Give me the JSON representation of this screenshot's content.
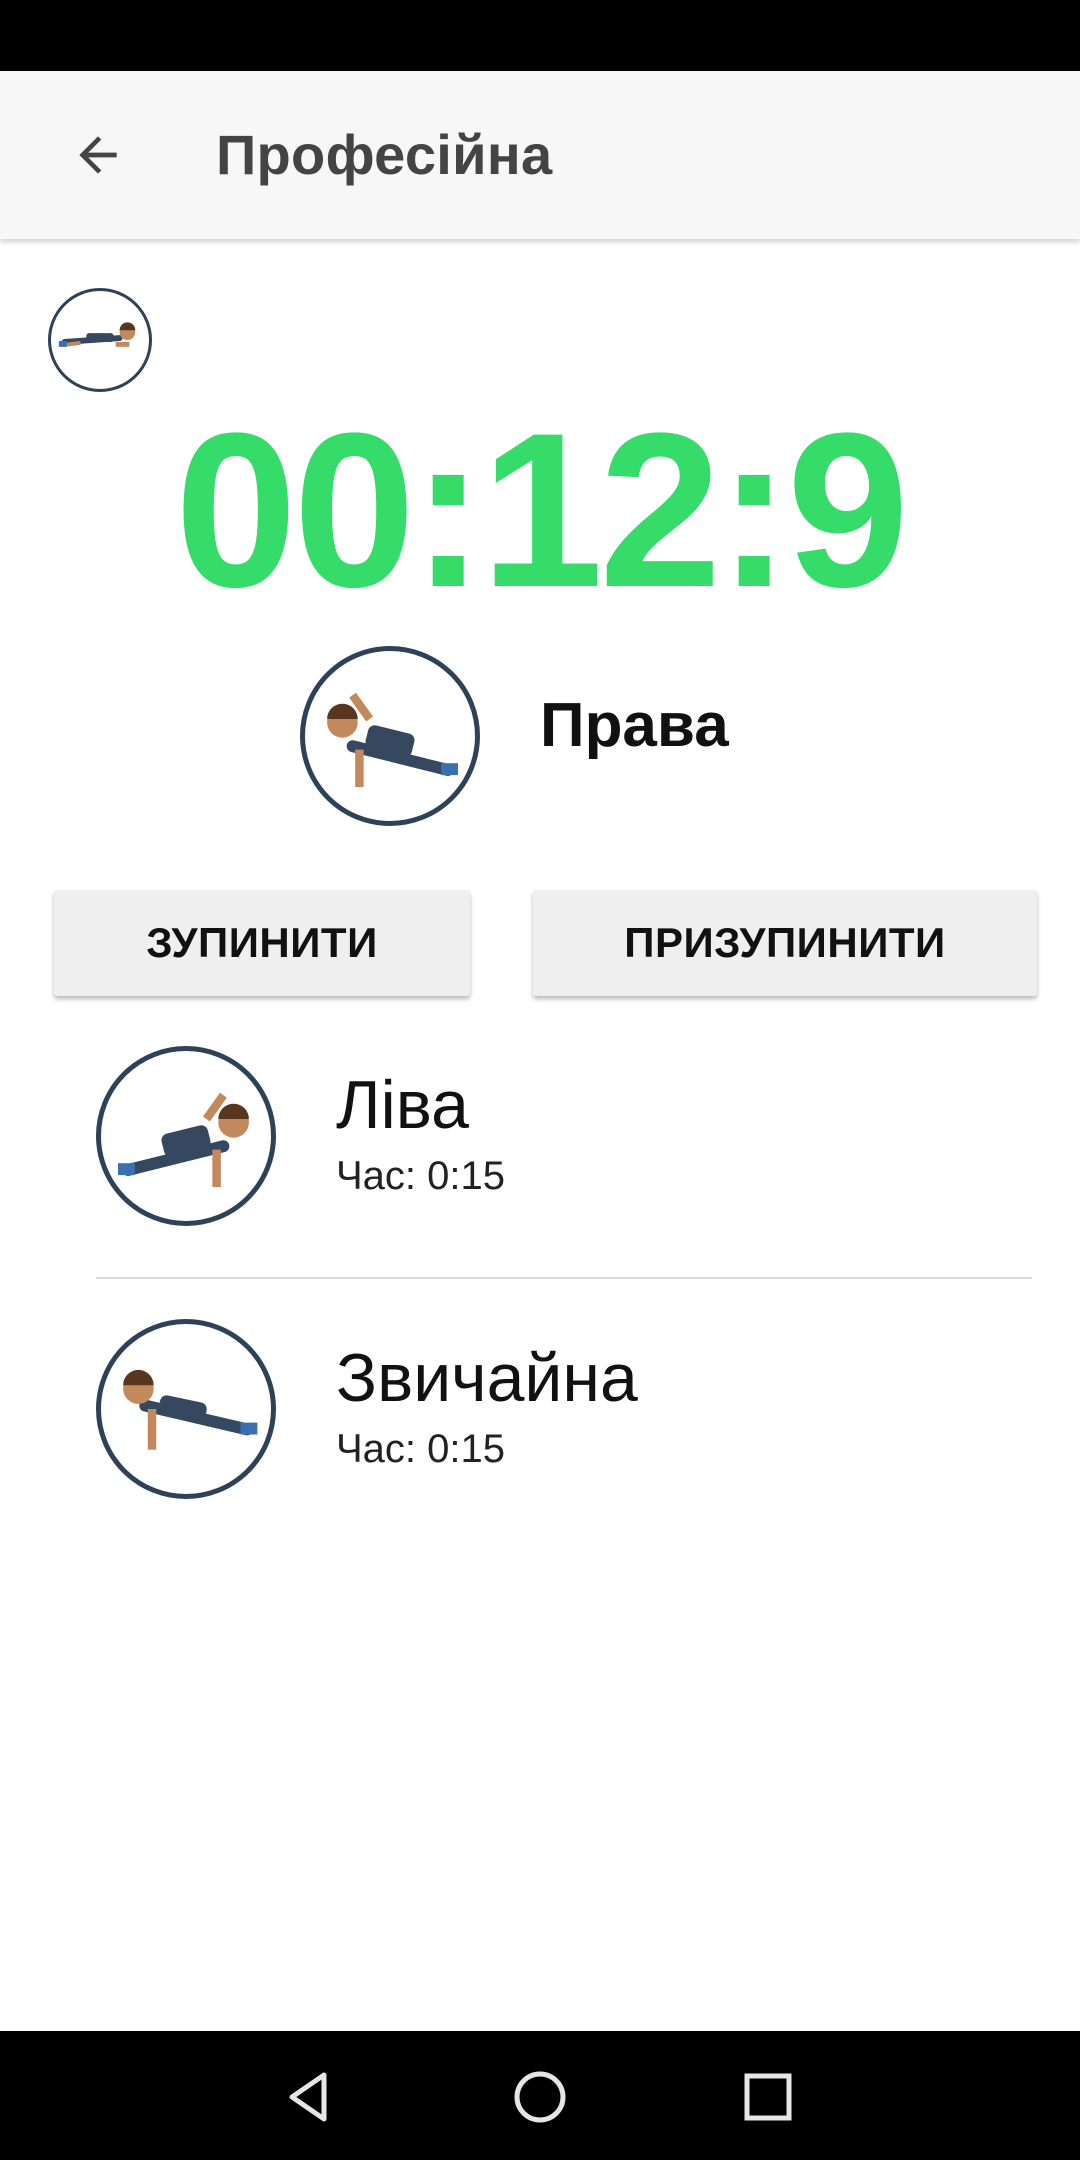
{
  "app_bar": {
    "title": "Професійна",
    "back_icon": "arrow-back-icon"
  },
  "timer": {
    "value": "00:12:9",
    "color": "#35dc6a"
  },
  "current_exercise": {
    "name": "Права",
    "icon": "side-plank-right-icon"
  },
  "buttons": {
    "stop_label": "ЗУПИНИТИ",
    "pause_label": "ПРИЗУПИНИТИ"
  },
  "exercises": [
    {
      "name": "Ліва",
      "time": "Час: 0:15",
      "icon": "side-plank-left-icon"
    },
    {
      "name": "Звичайна",
      "time": "Час: 0:15",
      "icon": "plank-icon"
    }
  ],
  "nav": {
    "back_icon": "triangle-back-icon",
    "home_icon": "circle-home-icon",
    "recents_icon": "square-recents-icon"
  },
  "colors": {
    "accent": "#35dc6a",
    "avatar_ring": "#2d4259",
    "app_bar_bg": "#f7f7f7"
  }
}
